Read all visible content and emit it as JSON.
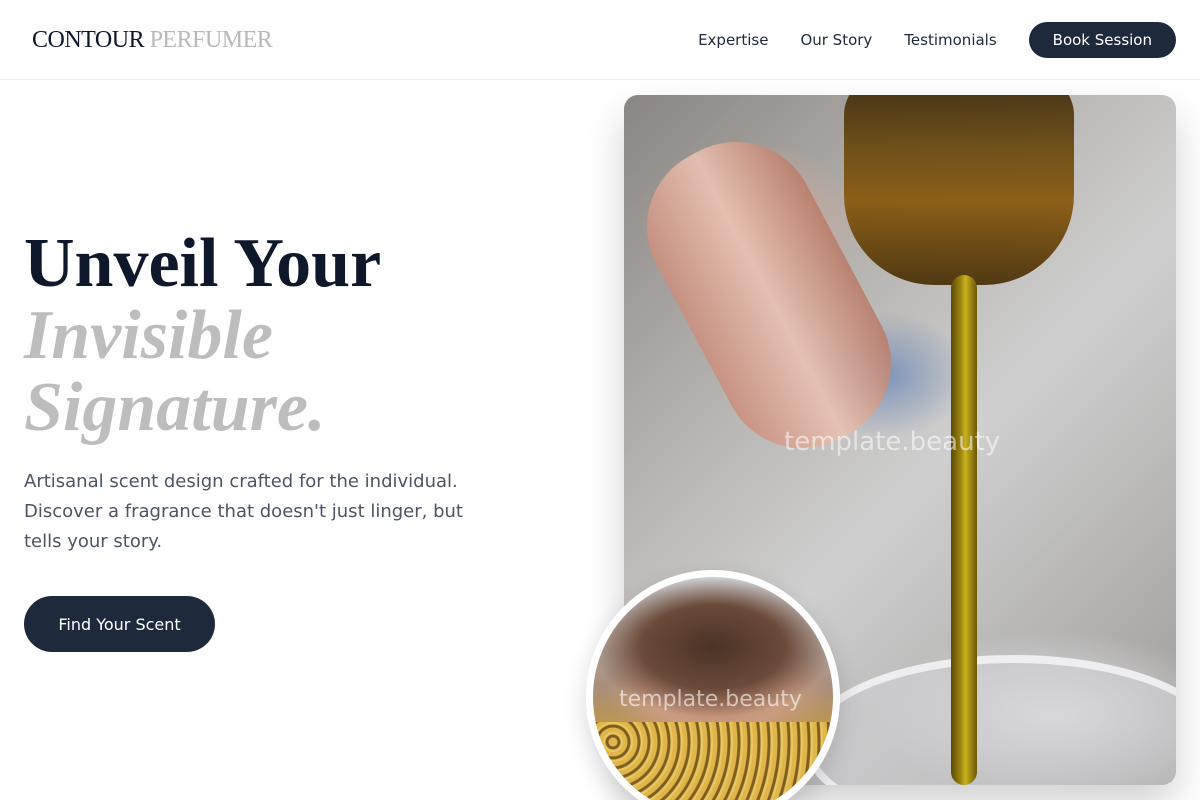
{
  "header": {
    "brand_primary": "CONTOUR",
    "brand_secondary": "PERFUMER",
    "nav": [
      "Expertise",
      "Our Story",
      "Testimonials"
    ],
    "cta_label": "Book Session"
  },
  "hero": {
    "title_line1": "Unveil Your",
    "title_line2": "Invisible",
    "title_line3": "Signature.",
    "subtitle": "Artisanal scent design crafted for the individual. Discover a fragrance that doesn't just linger, but tells your story.",
    "cta_label": "Find Your Scent"
  },
  "images": {
    "main_watermark": "template.beauty",
    "circle_watermark": "template.beauty"
  },
  "colors": {
    "primary": "#1e293b",
    "title_dark": "#0f172a",
    "title_muted": "#bdbdbd",
    "brand_muted": "#b9b9b9",
    "background": "#ffffff"
  }
}
